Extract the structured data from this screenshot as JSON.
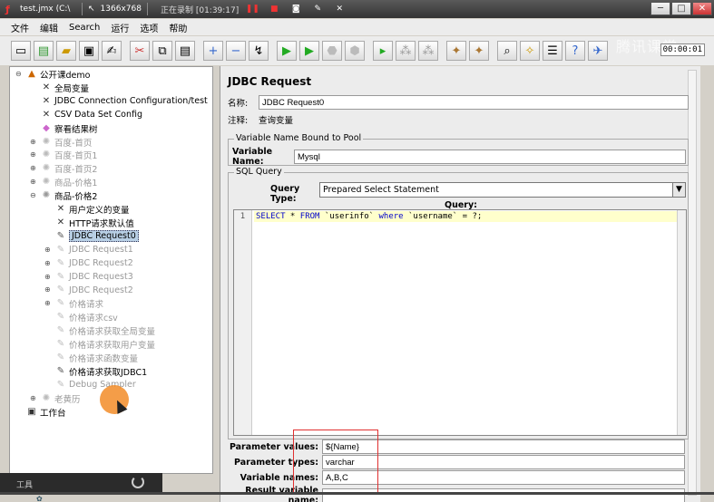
{
  "window": {
    "title": "test.jmx (C:\\",
    "resolution": "1366x768",
    "recording_text": "正在录制 [01:39:17]",
    "control_buttons": [
      "minimize",
      "maximize",
      "close"
    ]
  },
  "menu": [
    "文件",
    "编辑",
    "Search",
    "运行",
    "选项",
    "帮助"
  ],
  "toolbar": {
    "timer": "00:00:01",
    "watermark": "腾讯课堂"
  },
  "tree": {
    "nodes": [
      {
        "label": "公开课demo",
        "icon": "testplan-icon",
        "disabled": false
      },
      {
        "label": "全局变量",
        "icon": "config-icon",
        "disabled": false
      },
      {
        "label": "JDBC Connection Configuration/test",
        "icon": "config-icon",
        "disabled": false
      },
      {
        "label": "CSV Data Set Config",
        "icon": "config-icon",
        "disabled": false
      },
      {
        "label": "察看结果树",
        "icon": "listener-icon",
        "disabled": false
      },
      {
        "label": "百度-首页",
        "icon": "thread-group-icon",
        "disabled": true
      },
      {
        "label": "百度-首页1",
        "icon": "thread-group-icon",
        "disabled": true
      },
      {
        "label": "百度-首页2",
        "icon": "thread-group-icon",
        "disabled": true
      },
      {
        "label": "商品-价格1",
        "icon": "thread-group-icon",
        "disabled": true
      },
      {
        "label": "商品-价格2",
        "icon": "thread-group-icon",
        "disabled": false
      },
      {
        "label": "用户定义的变量",
        "icon": "config-icon",
        "disabled": false
      },
      {
        "label": "HTTP请求默认值",
        "icon": "config-icon",
        "disabled": false
      },
      {
        "label": "JDBC Request0",
        "icon": "sampler-icon",
        "disabled": false,
        "selected": true
      },
      {
        "label": "JDBC Request1",
        "icon": "sampler-icon",
        "disabled": true
      },
      {
        "label": "JDBC Request2",
        "icon": "sampler-icon",
        "disabled": true
      },
      {
        "label": "JDBC Request3",
        "icon": "sampler-icon",
        "disabled": true
      },
      {
        "label": "JDBC Request2",
        "icon": "sampler-icon",
        "disabled": true
      },
      {
        "label": "价格请求",
        "icon": "sampler-icon",
        "disabled": true
      },
      {
        "label": "价格请求csv",
        "icon": "sampler-icon",
        "disabled": true
      },
      {
        "label": "价格请求获取全局变量",
        "icon": "sampler-icon",
        "disabled": true
      },
      {
        "label": "价格请求获取用户变量",
        "icon": "sampler-icon",
        "disabled": true
      },
      {
        "label": "价格请求函数变量",
        "icon": "sampler-icon",
        "disabled": true
      },
      {
        "label": "价格请求获取JDBC1",
        "icon": "sampler-icon",
        "disabled": false
      },
      {
        "label": "Debug Sampler",
        "icon": "sampler-icon",
        "disabled": true
      },
      {
        "label": "老黄历",
        "icon": "thread-group-icon",
        "disabled": true
      },
      {
        "label": "工作台",
        "icon": "workbench-icon",
        "disabled": false
      }
    ]
  },
  "panel": {
    "title": "JDBC Request",
    "name_label": "名称:",
    "name_value": "JDBC Request0",
    "comment_label": "注释:",
    "comment_value": "查询变量",
    "pool_group_title": "Variable Name Bound to Pool",
    "pool_label": "Variable Name:",
    "pool_value": "Mysql",
    "sql_group_title": "SQL Query",
    "query_type_label": "Query Type:",
    "query_type_value": "Prepared Select Statement",
    "query_label": "Query:",
    "line_number": "1",
    "query_parts": {
      "select": "SELECT",
      "star": " * ",
      "from": "FROM",
      "table": " `userinfo` ",
      "where": "where",
      "cond": " `username` = ?;"
    },
    "param_values_label": "Parameter values:",
    "param_values": "${Name}",
    "param_types_label": "Parameter types:",
    "param_types": "varchar",
    "var_names_label": "Variable names:",
    "var_names": "A,B,C",
    "result_var_label": "Result variable name:"
  },
  "overlay": {
    "tools_label": "工具"
  }
}
